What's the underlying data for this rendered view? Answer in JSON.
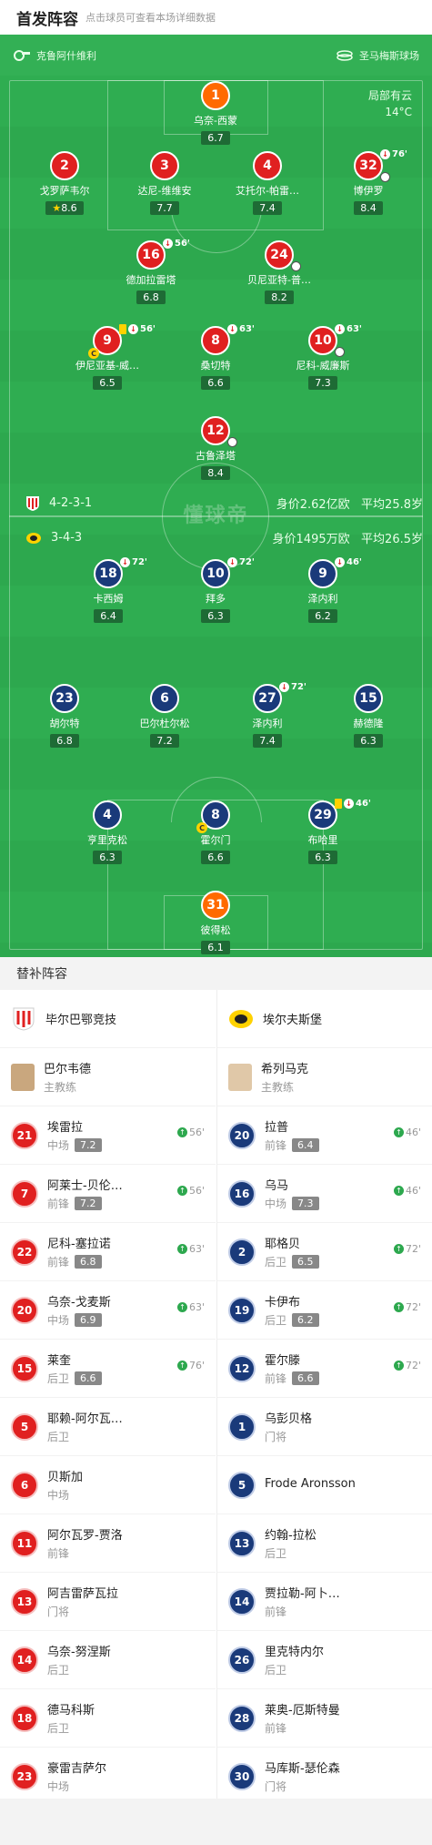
{
  "header": {
    "title": "首发阵容",
    "subtitle": "点击球员可查看本场详细数据"
  },
  "pitch": {
    "home_team": "克鲁阿什维利",
    "away_team": "圣马梅斯球场",
    "weather": "局部有云",
    "temperature": "14°C",
    "watermark": "懂球帝",
    "home_formation": "4-2-3-1",
    "home_value": "身价2.62亿欧",
    "home_age": "平均25.8岁",
    "away_formation": "3-4-3",
    "away_value": "身价1495万欧",
    "away_age": "平均26.5岁"
  },
  "home_players": [
    {
      "num": "1",
      "name": "乌奈-西蒙",
      "rating": "6.7",
      "gk": true
    },
    {
      "num": "2",
      "name": "戈罗萨韦尔",
      "rating": "8.6",
      "star": true
    },
    {
      "num": "3",
      "name": "达尼-维维安",
      "rating": "7.7"
    },
    {
      "num": "4",
      "name": "艾托尔-帕雷…",
      "rating": "7.4"
    },
    {
      "num": "32",
      "name": "博伊罗",
      "rating": "8.4",
      "sub": "76'"
    },
    {
      "num": "16",
      "name": "德加拉雷塔",
      "rating": "6.8",
      "sub": "56'"
    },
    {
      "num": "24",
      "name": "贝尼亚特-普…",
      "rating": "8.2"
    },
    {
      "num": "9",
      "name": "伊尼亚基-威…",
      "rating": "6.5",
      "sub": "56'"
    },
    {
      "num": "8",
      "name": "桑切特",
      "rating": "6.6",
      "sub": "63'"
    },
    {
      "num": "10",
      "name": "尼科-威廉斯",
      "rating": "7.3",
      "sub": "63'"
    },
    {
      "num": "12",
      "name": "古鲁泽塔",
      "rating": "8.4"
    }
  ],
  "away_players": [
    {
      "num": "18",
      "name": "卡西姆",
      "rating": "6.4",
      "sub": "72'"
    },
    {
      "num": "10",
      "name": "拜多",
      "rating": "6.3",
      "sub": "72'"
    },
    {
      "num": "9",
      "name": "泽内利",
      "rating": "6.2",
      "sub": "46'"
    },
    {
      "num": "23",
      "name": "胡尔特",
      "rating": "6.8"
    },
    {
      "num": "6",
      "name": "巴尔杜尔松",
      "rating": "7.2"
    },
    {
      "num": "27",
      "name": "泽内利",
      "rating": "7.4",
      "sub": "72'"
    },
    {
      "num": "15",
      "name": "赫德隆",
      "rating": "6.3"
    },
    {
      "num": "4",
      "name": "亨里克松",
      "rating": "6.3"
    },
    {
      "num": "8",
      "name": "霍尔门",
      "rating": "6.6"
    },
    {
      "num": "29",
      "name": "布哈里",
      "rating": "6.3",
      "sub": "46'"
    },
    {
      "num": "31",
      "name": "彼得松",
      "rating": "6.1",
      "gk": true
    }
  ],
  "subs_title": "替补阵容",
  "home_subs": {
    "team": "毕尔巴鄂竞技",
    "coach": {
      "name": "巴尔韦德",
      "role": "主教练"
    },
    "players": [
      {
        "num": "21",
        "name": "埃雷拉",
        "pos": "中场",
        "rating": "7.2",
        "time": "56'"
      },
      {
        "num": "7",
        "name": "阿莱士-贝伦…",
        "pos": "前锋",
        "rating": "7.2",
        "time": "56'"
      },
      {
        "num": "22",
        "name": "尼科-塞拉诺",
        "pos": "前锋",
        "rating": "6.8",
        "time": "63'"
      },
      {
        "num": "20",
        "name": "乌奈-戈麦斯",
        "pos": "中场",
        "rating": "6.9",
        "time": "63'"
      },
      {
        "num": "15",
        "name": "莱奎",
        "pos": "后卫",
        "rating": "6.6",
        "time": "76'"
      },
      {
        "num": "5",
        "name": "耶赖-阿尔瓦…",
        "pos": "后卫"
      },
      {
        "num": "6",
        "name": "贝斯加",
        "pos": "中场"
      },
      {
        "num": "11",
        "name": "阿尔瓦罗-贾洛",
        "pos": "前锋"
      },
      {
        "num": "13",
        "name": "阿吉雷萨瓦拉",
        "pos": "门将"
      },
      {
        "num": "14",
        "name": "乌奈-努涅斯",
        "pos": "后卫"
      },
      {
        "num": "18",
        "name": "德马科斯",
        "pos": "后卫"
      },
      {
        "num": "23",
        "name": "豪雷吉萨尔",
        "pos": "中场"
      }
    ]
  },
  "away_subs": {
    "team": "埃尔夫斯堡",
    "coach": {
      "name": "希列马克",
      "role": "主教练"
    },
    "players": [
      {
        "num": "20",
        "name": "拉普",
        "pos": "前锋",
        "rating": "6.4",
        "time": "46'"
      },
      {
        "num": "16",
        "name": "乌马",
        "pos": "中场",
        "rating": "7.3",
        "time": "46'"
      },
      {
        "num": "2",
        "name": "耶格贝",
        "pos": "后卫",
        "rating": "6.5",
        "time": "72'"
      },
      {
        "num": "19",
        "name": "卡伊布",
        "pos": "后卫",
        "rating": "6.2",
        "time": "72'"
      },
      {
        "num": "12",
        "name": "霍尔滕",
        "pos": "前锋",
        "rating": "6.6",
        "time": "72'"
      },
      {
        "num": "1",
        "name": "乌彭贝格",
        "pos": "门将"
      },
      {
        "num": "5",
        "name": "Frode Aronsson",
        "pos": ""
      },
      {
        "num": "13",
        "name": "约翰-拉松",
        "pos": "后卫"
      },
      {
        "num": "14",
        "name": "贾拉勒-阿卜…",
        "pos": "前锋"
      },
      {
        "num": "26",
        "name": "里克特内尔",
        "pos": "后卫"
      },
      {
        "num": "28",
        "name": "莱奥-厄斯特曼",
        "pos": "前锋"
      },
      {
        "num": "30",
        "name": "马库斯-瑟伦森",
        "pos": "门将"
      }
    ]
  }
}
